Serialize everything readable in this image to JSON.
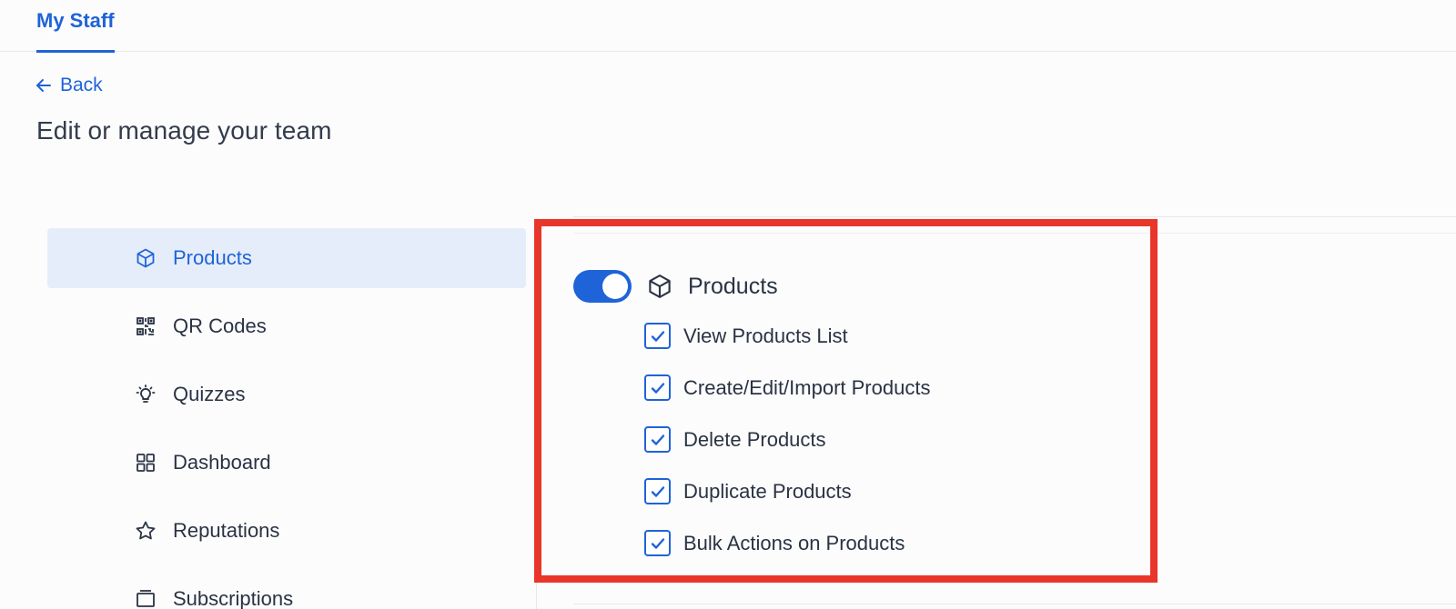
{
  "tabs": [
    {
      "label": "My Staff",
      "active": true
    }
  ],
  "back_label": "Back",
  "page_title": "Edit or manage your team",
  "sidebar": {
    "items": [
      {
        "label": "Products",
        "icon": "cube-icon",
        "active": true
      },
      {
        "label": "QR Codes",
        "icon": "qr-code-icon",
        "active": false
      },
      {
        "label": "Quizzes",
        "icon": "lightbulb-icon",
        "active": false
      },
      {
        "label": "Dashboard",
        "icon": "grid-icon",
        "active": false
      },
      {
        "label": "Reputations",
        "icon": "star-icon",
        "active": false
      },
      {
        "label": "Subscriptions",
        "icon": "subscriptions-icon",
        "active": false
      }
    ]
  },
  "permissions": {
    "section_title": "Products",
    "section_icon": "cube-icon",
    "toggle_on": true,
    "items": [
      {
        "label": "View Products List",
        "checked": true
      },
      {
        "label": "Create/Edit/Import Products",
        "checked": true
      },
      {
        "label": "Delete Products",
        "checked": true
      },
      {
        "label": "Duplicate Products",
        "checked": true
      },
      {
        "label": "Bulk Actions on Products",
        "checked": true
      }
    ]
  },
  "colors": {
    "accent": "#1f63d8",
    "active_bg": "#e6edfa",
    "highlight": "#e8362a",
    "text": "#2a3343"
  }
}
